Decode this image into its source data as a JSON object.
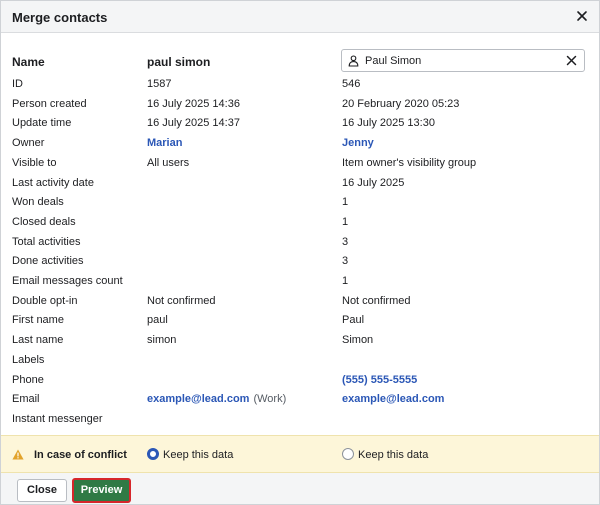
{
  "dialog": {
    "title": "Merge contacts"
  },
  "name_row": {
    "label": "Name",
    "left_value": "paul simon",
    "selector_value": "Paul Simon"
  },
  "rows": [
    {
      "label": "ID",
      "left": "1587",
      "right": "546"
    },
    {
      "label": "Person created",
      "left": "16 July 2025 14:36",
      "right": "20 February 2020 05:23"
    },
    {
      "label": "Update time",
      "left": "16 July 2025 14:37",
      "right": "16 July 2025 13:30"
    },
    {
      "label": "Owner",
      "left": "Marian",
      "right": "Jenny"
    },
    {
      "label": "Visible to",
      "left": "All users",
      "right": "Item owner's visibility group"
    },
    {
      "label": "Last activity date",
      "left": "",
      "right": "16 July 2025"
    },
    {
      "label": "Won deals",
      "left": "",
      "right": "1"
    },
    {
      "label": "Closed deals",
      "left": "",
      "right": "1"
    },
    {
      "label": "Total activities",
      "left": "",
      "right": "3"
    },
    {
      "label": "Done activities",
      "left": "",
      "right": "3"
    },
    {
      "label": "Email messages count",
      "left": "",
      "right": "1"
    },
    {
      "label": "Double opt-in",
      "left": "Not confirmed",
      "right": "Not confirmed"
    },
    {
      "label": "First name",
      "left": "paul",
      "right": "Paul"
    },
    {
      "label": "Last name",
      "left": "simon",
      "right": "Simon"
    },
    {
      "label": "Labels",
      "left": "",
      "right": ""
    },
    {
      "label": "Phone",
      "left": "",
      "right": "(555) 555-5555"
    },
    {
      "label": "Email",
      "left": "example@lead.com",
      "left_suffix": "(Work)",
      "right": "example@lead.com"
    },
    {
      "label": "Instant messenger",
      "left": "",
      "right": ""
    }
  ],
  "conflict": {
    "label": "In case of conflict",
    "option_left": "Keep this data",
    "option_right": "Keep this data",
    "selected": "left"
  },
  "footer": {
    "close_label": "Close",
    "preview_label": "Preview"
  },
  "colors": {
    "link": "#2b57b6",
    "primary_button": "#2f7a45",
    "highlight_border": "#d6262b",
    "conflict_bg": "#fdf6d9",
    "warning_icon": "#e2a32b"
  },
  "icons": {
    "close": "close-icon",
    "person": "person-icon",
    "clear": "clear-icon",
    "warning": "warning-icon"
  }
}
